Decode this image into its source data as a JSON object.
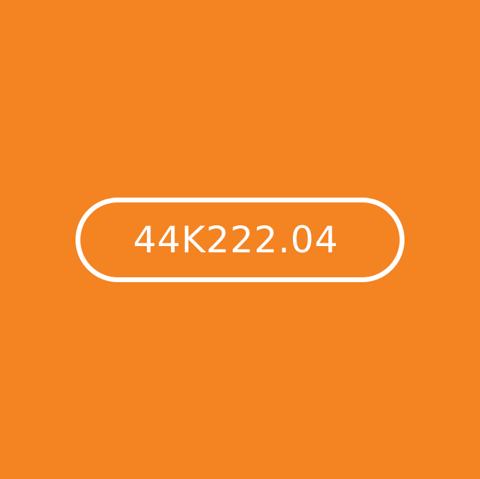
{
  "plate": {
    "text": "44K222.04"
  },
  "colors": {
    "background": "#F48322",
    "foreground": "#FFFFFF"
  }
}
